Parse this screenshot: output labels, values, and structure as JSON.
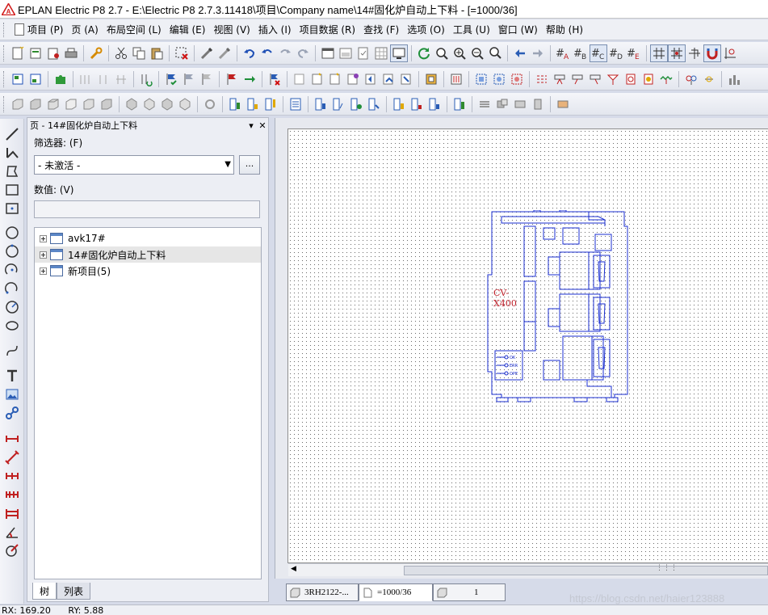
{
  "window": {
    "title": "EPLAN Electric P8 2.7 - E:\\Electric P8 2.7.3.11418\\项目\\Company name\\14#固化炉自动上下料 - [=1000/36]"
  },
  "menu": {
    "items": [
      "项目 (P)",
      "页 (A)",
      "布局空间 (L)",
      "编辑 (E)",
      "视图 (V)",
      "插入 (I)",
      "项目数据 (R)",
      "查找 (F)",
      "选项 (O)",
      "工具 (U)",
      "窗口 (W)",
      "帮助 (H)"
    ]
  },
  "toolbar": {
    "text_buttons": {
      "w1": "#",
      "w2": "#",
      "w3": "#",
      "w4": "#",
      "w5": "#"
    }
  },
  "panel": {
    "title": "页 - 14#固化炉自动上下料",
    "filter_label": "筛选器: (F)",
    "filter_value": "- 未激活 -",
    "more_button": "...",
    "value_label": "数值: (V)",
    "tree": [
      {
        "label": "avk17#",
        "selected": false
      },
      {
        "label": "14#固化炉自动上下料",
        "selected": true
      },
      {
        "label": "新项目(5)",
        "selected": false
      }
    ],
    "tabs": [
      "树",
      "列表"
    ]
  },
  "drawing": {
    "device_label_line1": "CV-",
    "device_label_line2": "X400",
    "led_labels": [
      "OK",
      "ERR",
      "OPE"
    ],
    "device_color": "#1b2fd0",
    "label_color": "#c0202a"
  },
  "page_tabs": [
    {
      "label": "3RH2122-...",
      "active": false
    },
    {
      "label": "=1000/36",
      "active": true
    },
    {
      "label": "1",
      "active": false
    }
  ],
  "watermark": "https://blog.csdn.net/haier123888",
  "status": {
    "rx": "RX: 169.20",
    "ry": "RY: 5.88"
  }
}
